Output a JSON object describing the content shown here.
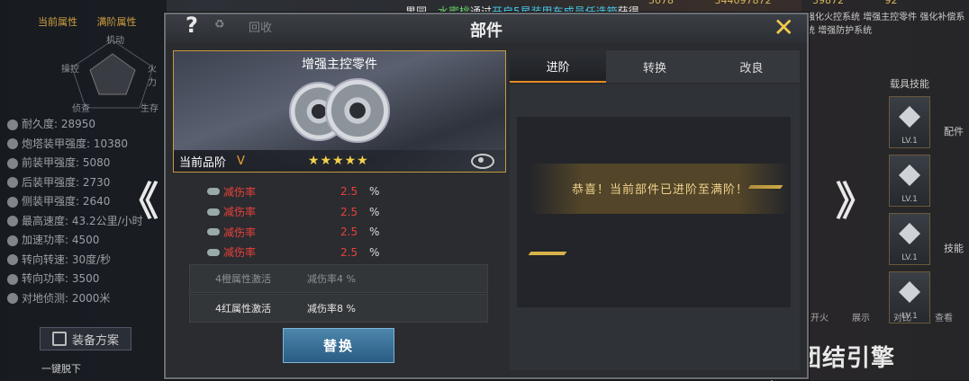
{
  "marquee": {
    "prefix": "果园 - ",
    "name": "水蜜桃",
    "mid": "通过",
    "highlight": "开启5星装甲车成员任选箱",
    "suffix": "获得"
  },
  "top_numbers": [
    "5078",
    "344097872",
    "39872",
    "92"
  ],
  "left_panel": {
    "tabs": [
      "当前属性",
      "满阶属性"
    ],
    "radar_labels": [
      "机动",
      "操控",
      "火力",
      "侦查",
      "生存"
    ],
    "stats": [
      "耐久度: 28950",
      "炮塔装甲强度: 10380",
      "前装甲强度: 5080",
      "后装甲强度: 2730",
      "侧装甲强度: 2640",
      "最高速度: 43.2公里/小时",
      "加速功率: 4500",
      "转向转速: 30度/秒",
      "转向功率: 3500",
      "对地侦测: 2000米"
    ],
    "equip_plan": "装备方案",
    "bottom_btn": "一键脱下"
  },
  "right_side": {
    "top_labels": [
      "强化火控系统",
      "增强主控零件",
      "强化补偿系统",
      "增强防护系统"
    ],
    "skill_title": "载具技能",
    "skills": [
      {
        "lv": "LV.1"
      },
      {
        "lv": "LV.1"
      },
      {
        "lv": "LV.1"
      },
      {
        "lv": "LV.1"
      }
    ],
    "label_parts": "配件",
    "label_skills": "技能",
    "bottom_icons": [
      "开火",
      "展示",
      "对比",
      "查看"
    ],
    "logo_text": "团结引擎"
  },
  "modal": {
    "title": "部件",
    "head_faded1": "?",
    "head_faded2": "回收",
    "close": "✕",
    "part": {
      "name": "增强主控零件",
      "grade_label": "当前品阶",
      "grade_value": "V",
      "stars": "★★★★★"
    },
    "attributes": [
      {
        "name": "减伤率",
        "value": "2.5",
        "unit": "%"
      },
      {
        "name": "减伤率",
        "value": "2.5",
        "unit": "%"
      },
      {
        "name": "减伤率",
        "value": "2.5",
        "unit": "%"
      },
      {
        "name": "减伤率",
        "value": "2.5",
        "unit": "%"
      }
    ],
    "sets": [
      {
        "label": "4橙属性激活",
        "value": "减伤率4 %"
      },
      {
        "label": "4红属性激活",
        "value": "减伤率8 %"
      }
    ],
    "replace_button": "替换",
    "tabs": [
      "进阶",
      "转换",
      "改良"
    ],
    "message": "恭喜！当前部件已进阶至满阶！"
  },
  "nav": {
    "left": "《",
    "right": "》"
  },
  "colors": {
    "accent": "#e78a24",
    "attr_red": "#e8413a",
    "gold": "#f3d24b",
    "button_blue": "#2a5c83"
  }
}
